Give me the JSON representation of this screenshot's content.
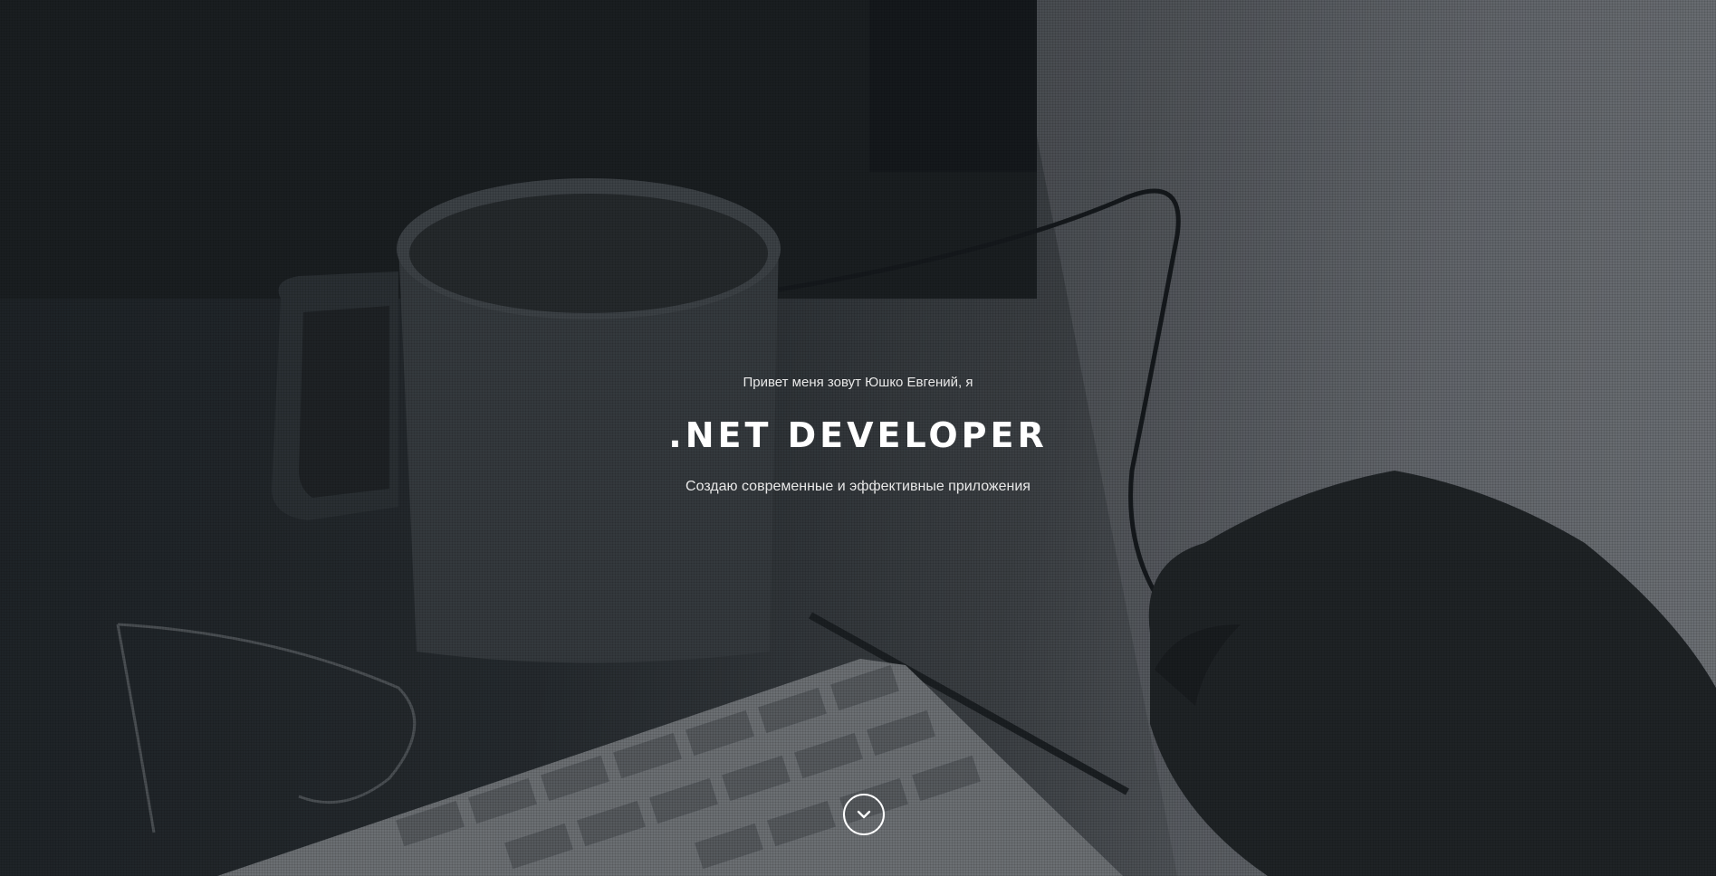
{
  "hero": {
    "intro": "Привет меня зовут Юшко Евгений, я",
    "title": ".NET DEVELOPER",
    "subtitle": "Создаю современные и эффективные приложения"
  },
  "scroll_button": {
    "icon": "chevron-down-icon"
  },
  "colors": {
    "text": "#ffffff",
    "overlay_dark": "#1f2427",
    "overlay_light": "#6e7276"
  }
}
